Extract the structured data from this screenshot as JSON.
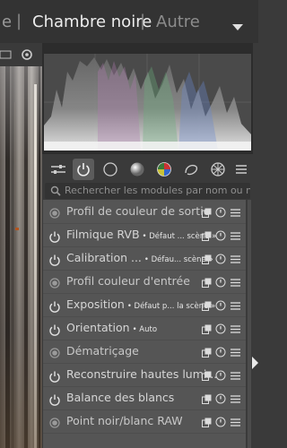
{
  "views": {
    "prev_label": "e",
    "active_label": "Chambre noire",
    "next_label": "Autre",
    "separator": "|"
  },
  "search": {
    "placeholder": "Rechercher les modules par nom ou mo..."
  },
  "module_groups": [
    {
      "icon": "presets-icon"
    },
    {
      "icon": "power-icon",
      "active": true
    },
    {
      "icon": "circle-icon"
    },
    {
      "icon": "tone-icon"
    },
    {
      "icon": "color-icon"
    },
    {
      "icon": "correct-icon"
    },
    {
      "icon": "effects-icon"
    },
    {
      "icon": "menu-icon"
    }
  ],
  "modules": [
    {
      "label": "Profil de couleur de sortie",
      "sub": "",
      "state": "always-on"
    },
    {
      "label": "Filmique RVB",
      "sub": "• Défaut ... scène »",
      "state": "power"
    },
    {
      "label": "Calibration ...",
      "sub": "• Défau... scène »",
      "state": "power"
    },
    {
      "label": "Profil couleur d'entrée",
      "sub": "",
      "state": "always-on"
    },
    {
      "label": "Exposition",
      "sub": "• Défaut p... la scène »",
      "state": "power"
    },
    {
      "label": "Orientation",
      "sub": "• Auto",
      "state": "power"
    },
    {
      "label": "Dématriçage",
      "sub": "",
      "state": "always-on"
    },
    {
      "label": "Reconstruire hautes lumi...",
      "sub": "",
      "state": "power"
    },
    {
      "label": "Balance des blancs",
      "sub": "",
      "state": "power"
    },
    {
      "label": "Point noir/blanc RAW",
      "sub": "",
      "state": "always-on"
    }
  ],
  "colors": {
    "panel": "#555555",
    "background": "#3a3a3a",
    "text": "#d6d6d6"
  }
}
